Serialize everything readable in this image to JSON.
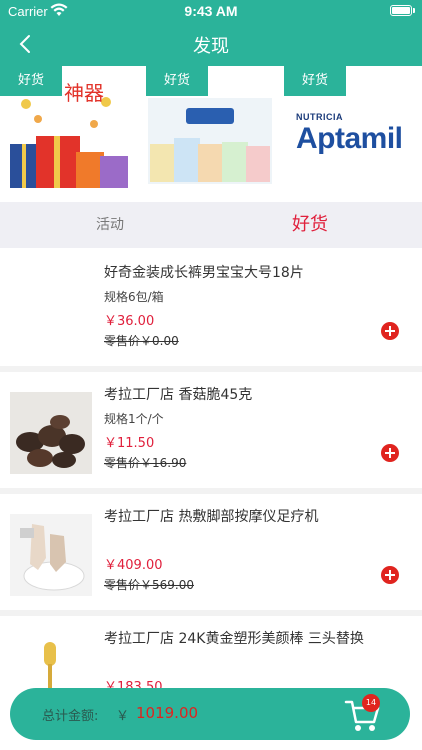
{
  "status_bar": {
    "carrier": "Carrier",
    "time": "9:43 AM"
  },
  "nav": {
    "title": "发现",
    "back_icon": "chevron-left-icon"
  },
  "banners": [
    {
      "badge": "好货",
      "image": "gift-boxes-promo",
      "text": "神器"
    },
    {
      "badge": "好货",
      "image": "baby-food-packs"
    },
    {
      "badge": "好货",
      "image": "aptamil-logo",
      "brand_small": "NUTRICIA",
      "brand": "Aptamil"
    }
  ],
  "tabs": [
    {
      "label": "活动",
      "active": false
    },
    {
      "label": "好货",
      "active": true
    }
  ],
  "products": [
    {
      "name": "好奇金装成长裤男宝宝大号18片",
      "spec": "规格6包/箱",
      "price": "￥36.00",
      "original": "零售价￥0.00",
      "image": "none"
    },
    {
      "name": "考拉工厂店 香菇脆45克",
      "spec": "规格1个/个",
      "price": "￥11.50",
      "original": "零售价￥16.90",
      "image": "mushroom-chips"
    },
    {
      "name": "考拉工厂店 热敷脚部按摩仪足疗机",
      "spec": "",
      "price": "￥409.00",
      "original": "零售价￥569.00",
      "image": "foot-massager"
    },
    {
      "name": "考拉工厂店 24K黄金塑形美颜棒 三头替换",
      "spec": "",
      "price": "￥183.50",
      "original": "",
      "image": "gold-beauty-bar"
    }
  ],
  "cart": {
    "label": "总计金额:",
    "currency": "￥",
    "total": "1019.00",
    "count": "14"
  },
  "colors": {
    "primary": "#2bb39a",
    "price": "#e0203c",
    "add_button": "#e0241f"
  }
}
